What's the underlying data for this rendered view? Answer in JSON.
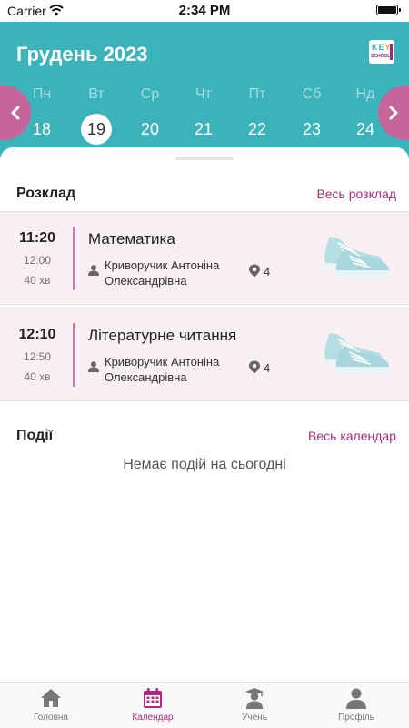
{
  "status_bar": {
    "carrier": "Carrier",
    "time": "2:34 PM"
  },
  "header": {
    "month_title": "Грудень 2023",
    "logo": {
      "line1_a": "KE",
      "line1_b": "Y",
      "line2": "SCHOOL"
    },
    "days": [
      {
        "name": "Пн",
        "num": "18",
        "selected": false
      },
      {
        "name": "Вт",
        "num": "19",
        "selected": true
      },
      {
        "name": "Ср",
        "num": "20",
        "selected": false
      },
      {
        "name": "Чт",
        "num": "21",
        "selected": false
      },
      {
        "name": "Пт",
        "num": "22",
        "selected": false
      },
      {
        "name": "Сб",
        "num": "23",
        "selected": false
      },
      {
        "name": "Нд",
        "num": "24",
        "selected": false
      }
    ]
  },
  "schedule": {
    "title": "Розклад",
    "link": "Весь розклад",
    "lessons": [
      {
        "start": "11:20",
        "end": "12:00",
        "duration": "40 хв",
        "subject": "Математика",
        "teacher": "Криворучик Антоніна Олександрівна",
        "room": "4"
      },
      {
        "start": "12:10",
        "end": "12:50",
        "duration": "40 хв",
        "subject": "Літературне читання",
        "teacher": "Криворучик Антоніна Олександрівна",
        "room": "4"
      }
    ]
  },
  "events": {
    "title": "Події",
    "link": "Весь календар",
    "empty_text": "Немає подій на сьогодні"
  },
  "tabbar": {
    "tabs": [
      {
        "label": "Головна",
        "icon": "home-icon",
        "active": false
      },
      {
        "label": "Календар",
        "icon": "calendar-icon",
        "active": true
      },
      {
        "label": "Учень",
        "icon": "student-icon",
        "active": false
      },
      {
        "label": "Профіль",
        "icon": "profile-icon",
        "active": false
      }
    ]
  },
  "colors": {
    "header": "#3ab3bb",
    "accent": "#b0287c",
    "arrow": "#c5659a",
    "lesson_bg": "#f8eff5",
    "lesson_bar": "#c77aac"
  }
}
